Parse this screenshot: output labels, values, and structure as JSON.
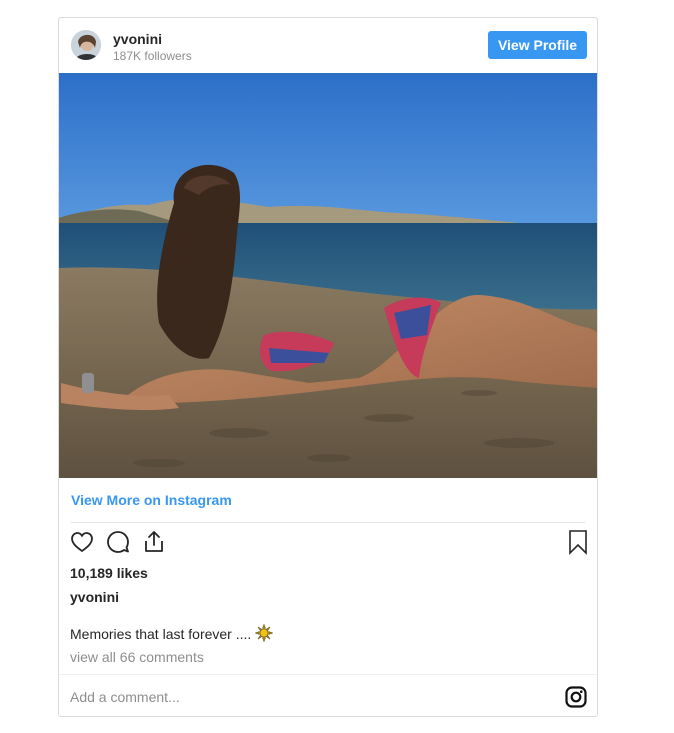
{
  "post": {
    "username": "yvonini",
    "followers": "187K followers",
    "view_profile_label": "View Profile",
    "view_more_label": "View More on Instagram",
    "likes": "10,189 likes",
    "caption_user": "yvonini",
    "caption_text": "Memories that last forever ....",
    "caption_emoji": "sun-emoji",
    "comments_link": "view all 66 comments",
    "comment_placeholder": "Add a comment...",
    "image_description_icon": "photo-beach",
    "icons": {
      "like": "heart-icon",
      "comment": "comment-icon",
      "share": "share-icon",
      "save": "bookmark-icon",
      "instagram": "instagram-icon"
    },
    "colors": {
      "accent": "#3897f0",
      "text": "#262626",
      "muted": "#8e8e8e"
    }
  }
}
